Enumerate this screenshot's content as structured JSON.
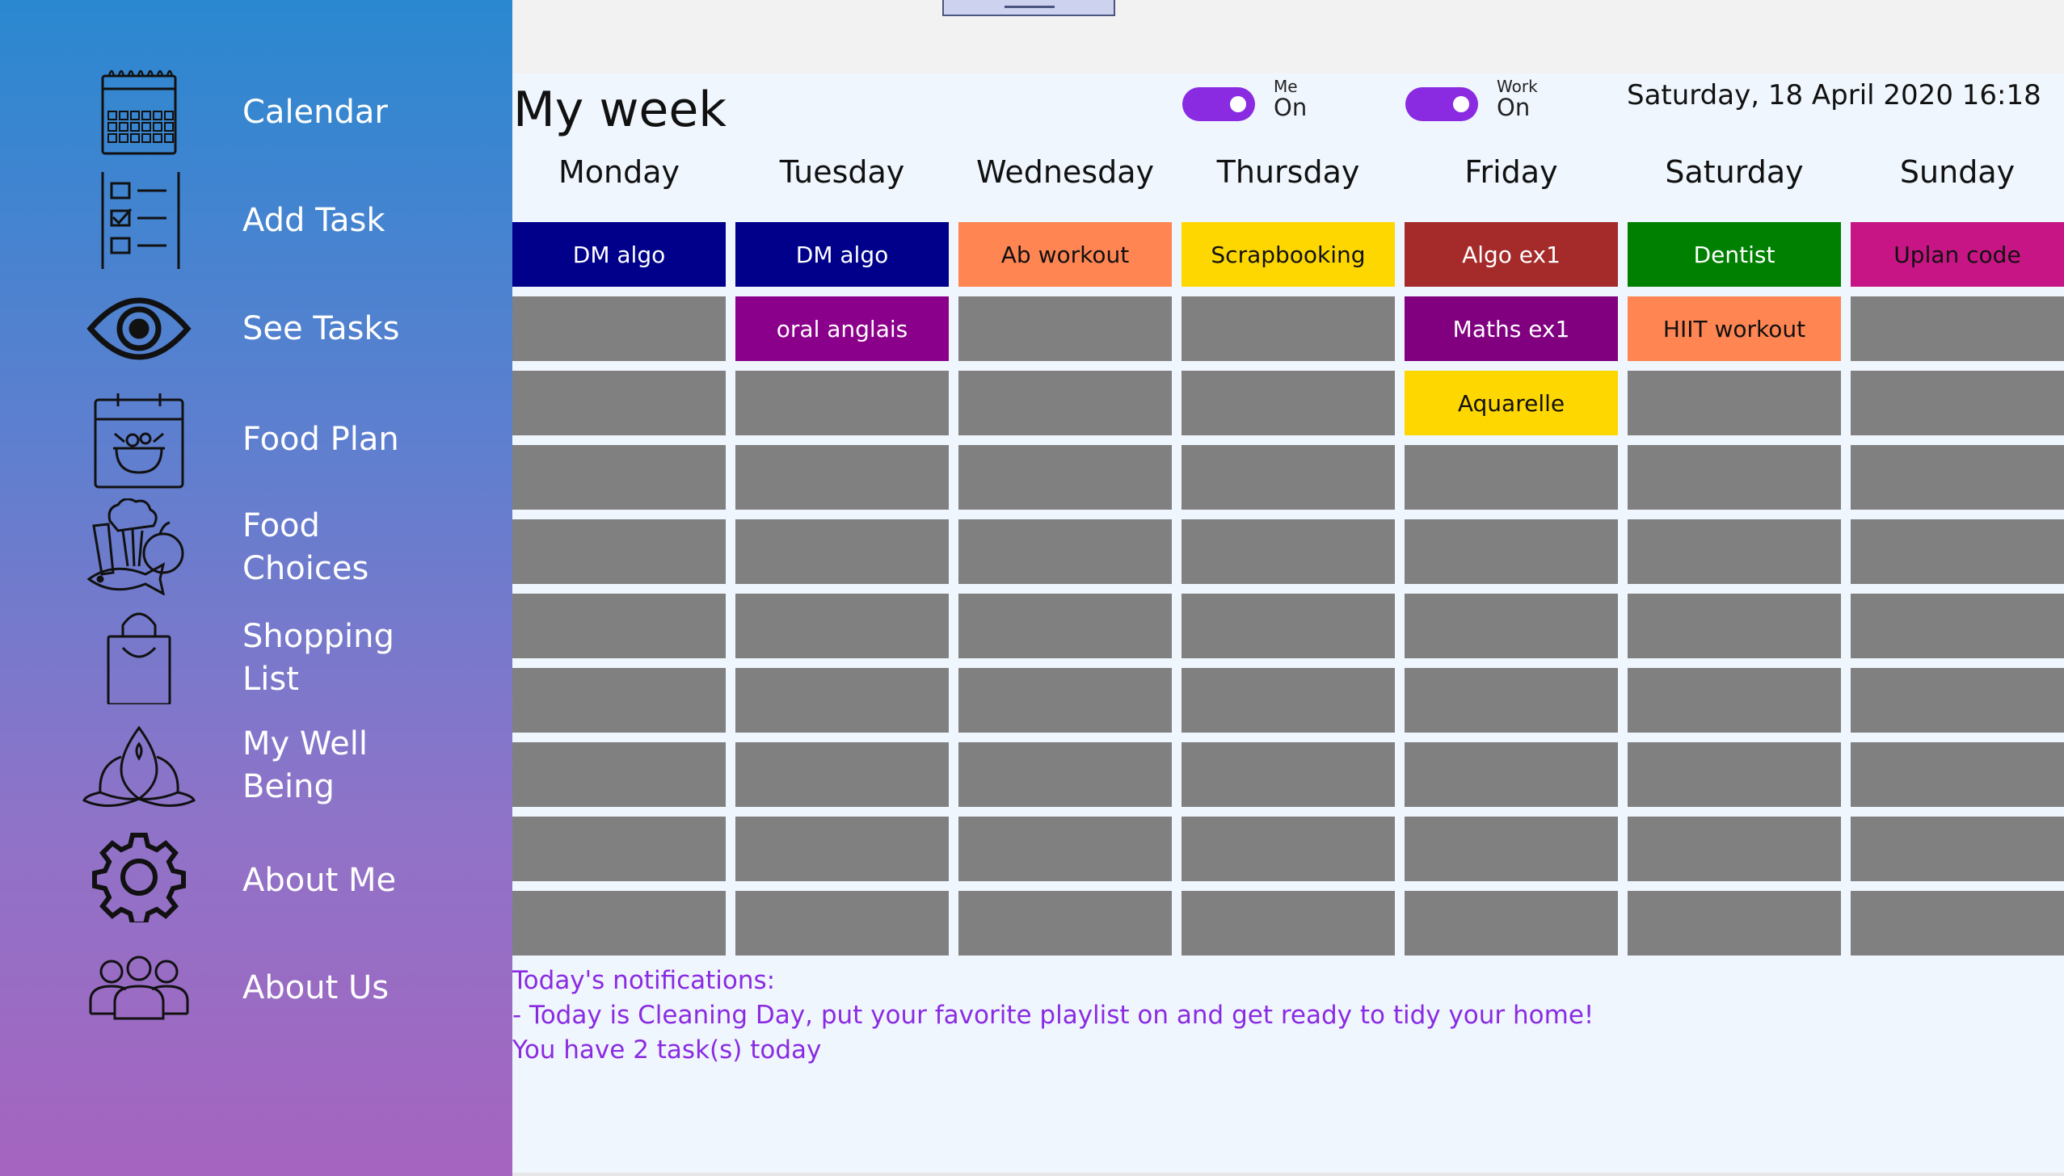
{
  "sidebar": {
    "items": [
      {
        "label": "Calendar",
        "icon": "calendar-icon"
      },
      {
        "label": "Add Task",
        "icon": "checklist-icon"
      },
      {
        "label": "See Tasks",
        "icon": "eye-icon"
      },
      {
        "label": "Food Plan",
        "icon": "food-plan-icon"
      },
      {
        "label": "Food\nChoices",
        "icon": "vegetables-icon"
      },
      {
        "label": "Shopping\nList",
        "icon": "shopping-bag-icon"
      },
      {
        "label": "My Well\nBeing",
        "icon": "lotus-icon"
      },
      {
        "label": "About Me",
        "icon": "gear-icon"
      },
      {
        "label": "About Us",
        "icon": "people-icon"
      }
    ]
  },
  "header": {
    "title": "My week",
    "toggles": [
      {
        "name": "Me",
        "state": "On"
      },
      {
        "name": "Work",
        "state": "On"
      }
    ],
    "datetime": "Saturday, 18 April 2020 16:18"
  },
  "week": {
    "days": [
      "Monday",
      "Tuesday",
      "Wednesday",
      "Thursday",
      "Friday",
      "Saturday",
      "Sunday"
    ],
    "columns": [
      [
        {
          "text": "DM algo",
          "color": "#00008b"
        }
      ],
      [
        {
          "text": "DM algo",
          "color": "#00008b"
        },
        {
          "text": "oral anglais",
          "color": "#8b008b"
        }
      ],
      [
        {
          "text": "Ab workout",
          "color": "#ff8552",
          "text_color": "#111111"
        }
      ],
      [
        {
          "text": "Scrapbooking",
          "color": "#ffd700",
          "text_color": "#111111"
        }
      ],
      [
        {
          "text": "Algo ex1",
          "color": "#a52a2a"
        },
        {
          "text": "Maths ex1",
          "color": "#800080"
        },
        {
          "text": "Aquarelle",
          "color": "#ffd700",
          "text_color": "#111111"
        }
      ],
      [
        {
          "text": "Dentist",
          "color": "#008000"
        },
        {
          "text": "HIIT workout",
          "color": "#ff8552",
          "text_color": "#111111"
        }
      ],
      [
        {
          "text": "Uplan code",
          "color": "#c71585",
          "text_color": "#111111"
        }
      ]
    ],
    "empty_color": "#808080"
  },
  "notifications": {
    "heading": "Today's notifications:",
    "lines": [
      "- Today is Cleaning Day, put your favorite playlist on and get ready to tidy your home!",
      "You have 2 task(s) today"
    ]
  },
  "colors": {
    "accent": "#8a2be2",
    "sidebar_top": "#2a88d0",
    "sidebar_bottom": "#a564bf"
  }
}
